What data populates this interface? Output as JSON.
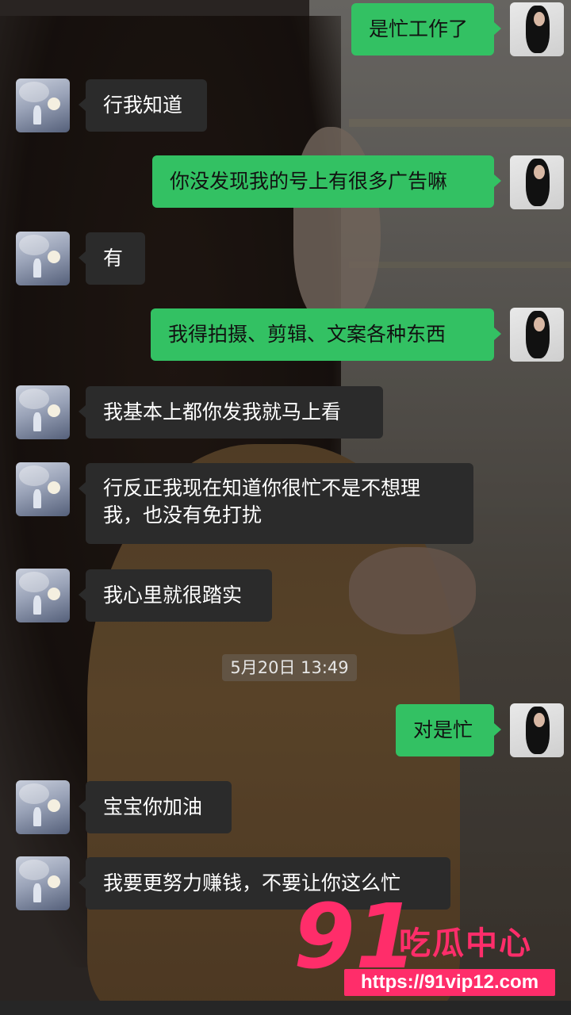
{
  "messages": [
    {
      "side": "out",
      "text": "是忙工作了"
    },
    {
      "side": "in",
      "text": "行我知道"
    },
    {
      "side": "out",
      "text": "你没发现我的号上有很多广告嘛"
    },
    {
      "side": "in",
      "text": "有"
    },
    {
      "side": "out",
      "text": "我得拍摄、剪辑、文案各种东西"
    },
    {
      "side": "in",
      "text": "我基本上都你发我就马上看"
    },
    {
      "side": "in",
      "text": "行反正我现在知道你很忙不是不想理我，也没有免打扰"
    },
    {
      "side": "in",
      "text": "我心里就很踏实"
    },
    {
      "side": "out",
      "text": "对是忙"
    },
    {
      "side": "in",
      "text": "宝宝你加油"
    },
    {
      "side": "in",
      "text": "我要更努力赚钱，不要让你这么忙"
    }
  ],
  "timestamp": "5月20日 13:49",
  "watermark": {
    "number": "91",
    "brand": "吃瓜中心",
    "url": "https://91vip12.com"
  },
  "colors": {
    "outgoing_bubble": "#33c163",
    "incoming_bubble": "#2b2b2b",
    "watermark": "#ff2d6a"
  },
  "icons": {
    "friend_avatar": "moon-landscape-avatar",
    "my_avatar": "woman-photo-avatar"
  }
}
